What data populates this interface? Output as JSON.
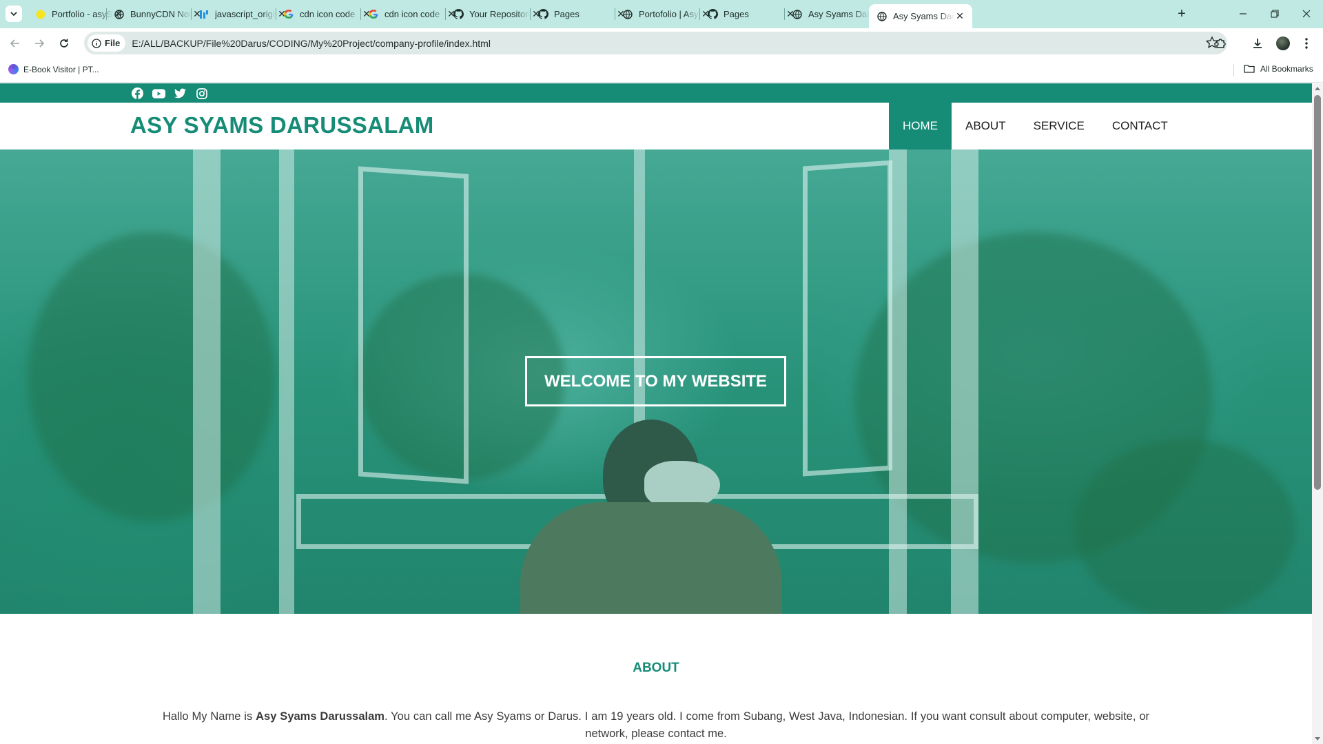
{
  "browser": {
    "tabs": [
      {
        "title": "Portfolio - asySyams",
        "icon": "yellow-circle-icon"
      },
      {
        "title": "BunnyCDN Notes",
        "icon": "globe-icon"
      },
      {
        "title": "javascript_original",
        "icon": "devicon-icon"
      },
      {
        "title": "cdn icon code",
        "icon": "google-icon"
      },
      {
        "title": "cdn icon code",
        "icon": "google-icon"
      },
      {
        "title": "Your Repositories",
        "icon": "github-icon"
      },
      {
        "title": "Pages",
        "icon": "github-icon"
      },
      {
        "title": "Portofolio | Asy Syams",
        "icon": "globe-icon"
      },
      {
        "title": "Pages",
        "icon": "github-icon"
      },
      {
        "title": "Asy Syams Darussalam",
        "icon": "globe-icon"
      },
      {
        "title": "Asy Syams Darussalam",
        "icon": "globe-icon",
        "active": true
      }
    ],
    "address": {
      "scheme_chip": "File",
      "url": "E:/ALL/BACKUP/File%20Darus/CODING/My%20Project/company-profile/index.html"
    },
    "bookmarks": {
      "item": "E-Book Visitor | PT...",
      "all": "All Bookmarks"
    },
    "colors": {
      "frame": "#bfe9e2",
      "omnibox": "#dfe9e7"
    }
  },
  "site": {
    "social": [
      "facebook-icon",
      "youtube-icon",
      "twitter-icon",
      "instagram-icon"
    ],
    "brand": "ASY SYAMS DARUSSALAM",
    "nav": [
      {
        "label": "HOME",
        "active": true
      },
      {
        "label": "ABOUT"
      },
      {
        "label": "SERVICE"
      },
      {
        "label": "CONTACT"
      }
    ],
    "hero": {
      "button": "WELCOME TO MY WEBSITE"
    },
    "about": {
      "title": "ABOUT",
      "text_before": "Hallo My Name is ",
      "name_bold": "Asy Syams Darussalam",
      "text_after": ". You can call me Asy Syams or Darus. I am 19 years old. I come from Subang, West Java, Indonesian. If you want consult about computer, website, or network, please contact me."
    },
    "colors": {
      "accent": "#168c77",
      "hero_overlay": "#169680"
    }
  }
}
